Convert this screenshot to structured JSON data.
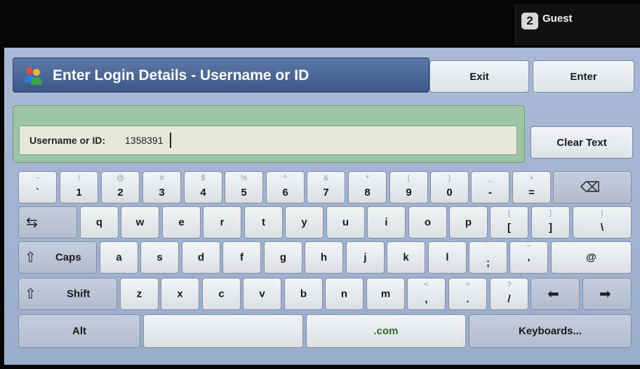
{
  "guest": {
    "icon_text": "2",
    "label": "Guest"
  },
  "header": {
    "title": "Enter Login Details - Username or ID",
    "title_icon": "users-icon"
  },
  "buttons": {
    "exit": "Exit",
    "enter": "Enter",
    "clear_text": "Clear Text"
  },
  "field": {
    "label": "Username or ID:",
    "value": "1358391"
  },
  "keyboard": {
    "row1": [
      {
        "name": "key-backtick",
        "sec": "~",
        "pri": "`"
      },
      {
        "name": "key-1",
        "sec": "!",
        "pri": "1"
      },
      {
        "name": "key-2",
        "sec": "@",
        "pri": "2"
      },
      {
        "name": "key-3",
        "sec": "#",
        "pri": "3"
      },
      {
        "name": "key-4",
        "sec": "$",
        "pri": "4"
      },
      {
        "name": "key-5",
        "sec": "%",
        "pri": "5"
      },
      {
        "name": "key-6",
        "sec": "^",
        "pri": "6"
      },
      {
        "name": "key-7",
        "sec": "&",
        "pri": "7"
      },
      {
        "name": "key-8",
        "sec": "*",
        "pri": "8"
      },
      {
        "name": "key-9",
        "sec": "(",
        "pri": "9"
      },
      {
        "name": "key-0",
        "sec": ")",
        "pri": "0"
      },
      {
        "name": "key-minus",
        "sec": "_",
        "pri": "-"
      },
      {
        "name": "key-equals",
        "sec": "+",
        "pri": "="
      }
    ],
    "row2": [
      {
        "name": "key-q",
        "pri": "q"
      },
      {
        "name": "key-w",
        "pri": "w"
      },
      {
        "name": "key-e",
        "pri": "e"
      },
      {
        "name": "key-r",
        "pri": "r"
      },
      {
        "name": "key-t",
        "pri": "t"
      },
      {
        "name": "key-y",
        "pri": "y"
      },
      {
        "name": "key-u",
        "pri": "u"
      },
      {
        "name": "key-i",
        "pri": "i"
      },
      {
        "name": "key-o",
        "pri": "o"
      },
      {
        "name": "key-p",
        "pri": "p"
      },
      {
        "name": "key-open-bracket",
        "sec": "{",
        "pri": "["
      },
      {
        "name": "key-close-bracket",
        "sec": "}",
        "pri": "]"
      },
      {
        "name": "key-backslash",
        "sec": "|",
        "pri": "\\"
      }
    ],
    "row3": [
      {
        "name": "key-a",
        "pri": "a"
      },
      {
        "name": "key-s",
        "pri": "s"
      },
      {
        "name": "key-d",
        "pri": "d"
      },
      {
        "name": "key-f",
        "pri": "f"
      },
      {
        "name": "key-g",
        "pri": "g"
      },
      {
        "name": "key-h",
        "pri": "h"
      },
      {
        "name": "key-j",
        "pri": "j"
      },
      {
        "name": "key-k",
        "pri": "k"
      },
      {
        "name": "key-l",
        "pri": "l"
      },
      {
        "name": "key-semicolon",
        "sec": ":",
        "pri": ";"
      },
      {
        "name": "key-quote",
        "sec": "\"",
        "pri": "'"
      },
      {
        "name": "key-at",
        "pri": "@"
      }
    ],
    "row4": [
      {
        "name": "key-z",
        "pri": "z"
      },
      {
        "name": "key-x",
        "pri": "x"
      },
      {
        "name": "key-c",
        "pri": "c"
      },
      {
        "name": "key-v",
        "pri": "v"
      },
      {
        "name": "key-b",
        "pri": "b"
      },
      {
        "name": "key-n",
        "pri": "n"
      },
      {
        "name": "key-m",
        "pri": "m"
      },
      {
        "name": "key-comma",
        "sec": "<",
        "pri": ","
      },
      {
        "name": "key-period",
        "sec": ">",
        "pri": "."
      },
      {
        "name": "key-slash",
        "sec": "?",
        "pri": "/"
      }
    ],
    "special": {
      "caps": "Caps",
      "shift": "Shift",
      "alt": "Alt",
      "space": "",
      "dotcom": ".com",
      "keyboards": "Keyboards...",
      "tab_icon": "tab-arrows-icon",
      "backspace_icon": "backspace-icon",
      "caps_icon": "caps-arrow-icon",
      "shift_icon": "shift-arrow-icon",
      "left_icon": "arrow-left-icon",
      "right_icon": "arrow-right-icon"
    }
  }
}
